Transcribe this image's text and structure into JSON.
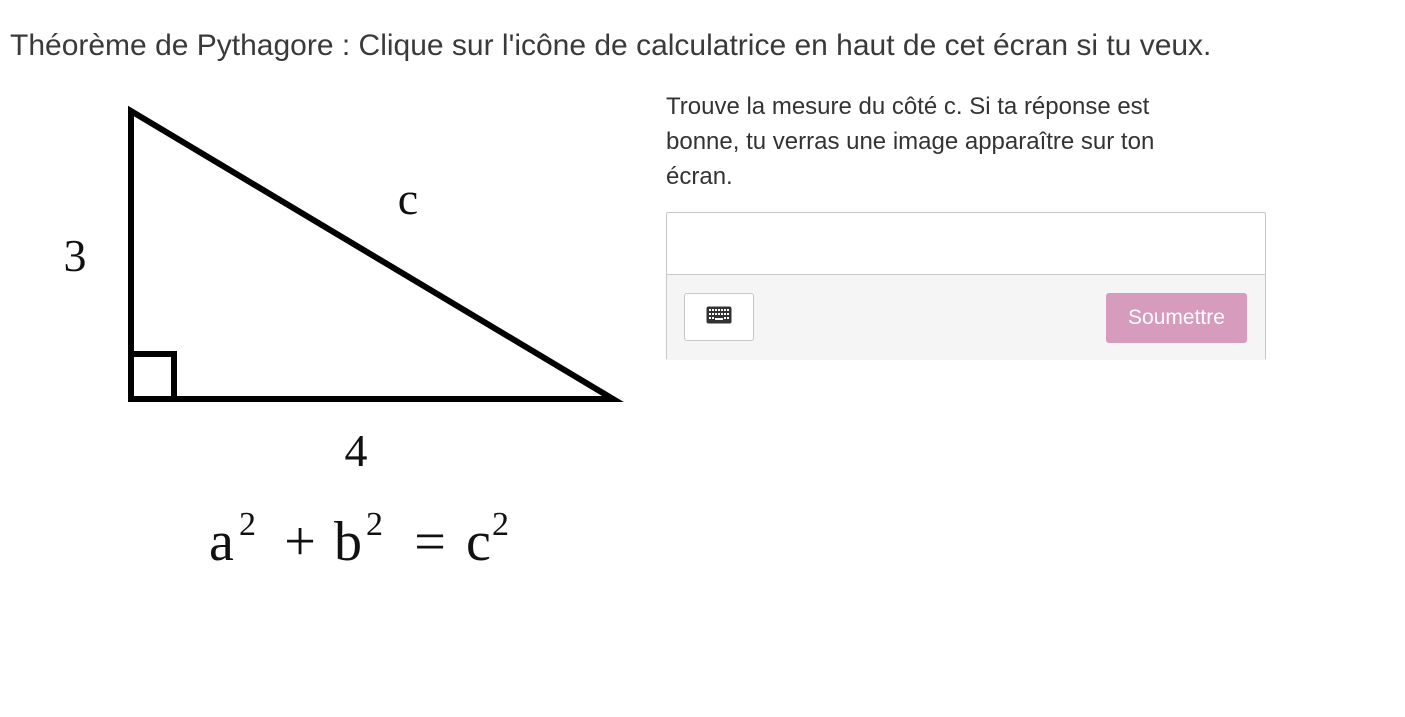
{
  "header": {
    "title": "Théorème de Pythagore : Clique sur l'icône de calculatrice en haut de cet écran si tu veux."
  },
  "figure": {
    "side_vertical": "3",
    "side_horizontal": "4",
    "side_hypotenuse": "c",
    "formula": {
      "a": "a",
      "plus": "+",
      "b": "b",
      "equals": "=",
      "c": "c",
      "exponent": "2"
    }
  },
  "question": {
    "prompt": "Trouve la mesure du côté c.  Si ta réponse est bonne, tu verras une image apparaître sur ton écran."
  },
  "answer": {
    "value": "",
    "placeholder": ""
  },
  "toolbar": {
    "keyboard_icon": "keyboard-icon",
    "submit_label": "Soumettre",
    "submit_color": "#d69bbd"
  }
}
